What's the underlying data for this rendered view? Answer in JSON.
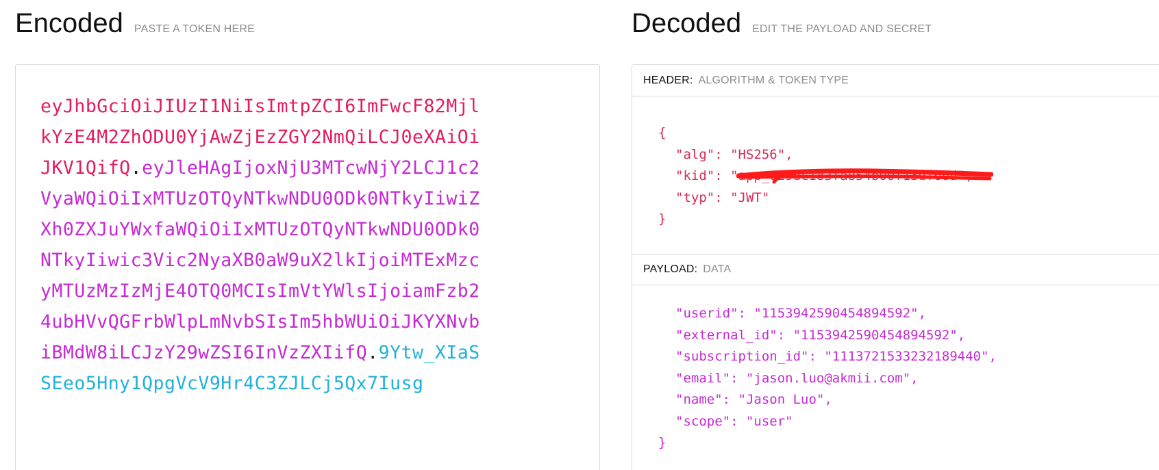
{
  "encoded": {
    "title": "Encoded",
    "subtitle": "PASTE A TOKEN HERE",
    "token_lines": [
      [
        {
          "part": "header",
          "text": "eyJhbGciOiJIUzI1NiIsImtpZCI6ImFwcF82Mjl"
        }
      ],
      [
        {
          "part": "header",
          "text": "kYzE4M2ZhODU0YjAwZjEzZGY2NmQiLCJ0eXAiOi"
        }
      ],
      [
        {
          "part": "header",
          "text": "JKV1QifQ"
        },
        {
          "part": "dot",
          "text": "."
        },
        {
          "part": "payload",
          "text": "eyJleHAgIjoxNjU3MTcwNjY2LCJ1c2"
        }
      ],
      [
        {
          "part": "payload",
          "text": "VyaWQiOiIxMTUzOTQyNTkwNDU0ODk0NTkyIiwiZ"
        }
      ],
      [
        {
          "part": "payload",
          "text": "Xh0ZXJuYWxfaWQiOiIxMTUzOTQyNTkwNDU0ODk0"
        }
      ],
      [
        {
          "part": "payload",
          "text": "NTkyIiwic3Vic2NyaXB0aW9uX2lkIjoiMTExMzc"
        }
      ],
      [
        {
          "part": "payload",
          "text": "yMTUzMzIzMjE4OTQ0MCIsImVtYWlsIjoiamFzb2"
        }
      ],
      [
        {
          "part": "payload",
          "text": "4ubHVvQGFrbWlpLmNvbSIsIm5hbWUiOiJKYXNvb"
        }
      ],
      [
        {
          "part": "payload",
          "text": "iBMdW8iLCJzY29wZSI6InVzZXIifQ"
        },
        {
          "part": "dot",
          "text": "."
        },
        {
          "part": "signature",
          "text": "9Ytw_XIaS"
        }
      ],
      [
        {
          "part": "signature",
          "text": "SEeo5Hny1QpgVcV9Hr4C3ZJLCj5Qx7Iusg"
        }
      ]
    ]
  },
  "decoded": {
    "title": "Decoded",
    "subtitle": "EDIT THE PAYLOAD AND SECRET",
    "header": {
      "label": "HEADER:",
      "description": "ALGORITHM & TOKEN TYPE",
      "json_lines": [
        "{",
        "\"alg\": \"HS256\",",
        "\"kid\": \"app_629dc183fa854b00f13df66d\",",
        "\"typ\": \"JWT\"",
        "}"
      ]
    },
    "payload": {
      "label": "PAYLOAD:",
      "description": "DATA",
      "json_lines": [
        "\"userid\": \"1153942590454894592\",",
        "\"external_id\": \"1153942590454894592\",",
        "\"subscription_id\": \"1113721533232189440\",",
        "\"email\": \"jason.luo@akmii.com\",",
        "\"name\": \"Jason Luo\",",
        "\"scope\": \"user\"",
        "}"
      ]
    }
  },
  "colors": {
    "header": "#e31c5f",
    "payload": "#c52ad3",
    "signature": "#1fb2d9",
    "redaction": "#ff1a1a"
  }
}
